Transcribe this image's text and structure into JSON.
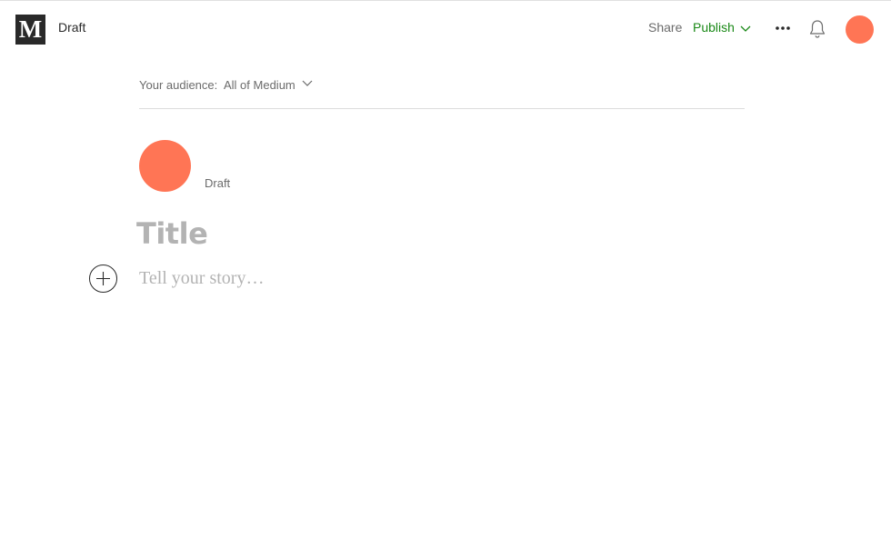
{
  "header": {
    "logo_text": "M",
    "status": "Draft",
    "share_label": "Share",
    "publish_label": "Publish",
    "more_icon": "more-horizontal-icon",
    "bell_icon": "bell-icon",
    "avatar_color": "#ff7555",
    "publish_color": "#1a8917"
  },
  "audience": {
    "prefix": "Your audience:",
    "value": "All of Medium",
    "icon": "chevron-down-icon"
  },
  "author": {
    "avatar_color": "#ff7555",
    "status": "Draft"
  },
  "editor": {
    "title_placeholder": "Title",
    "body_placeholder": "Tell your story…",
    "add_icon": "plus-circle-icon"
  }
}
